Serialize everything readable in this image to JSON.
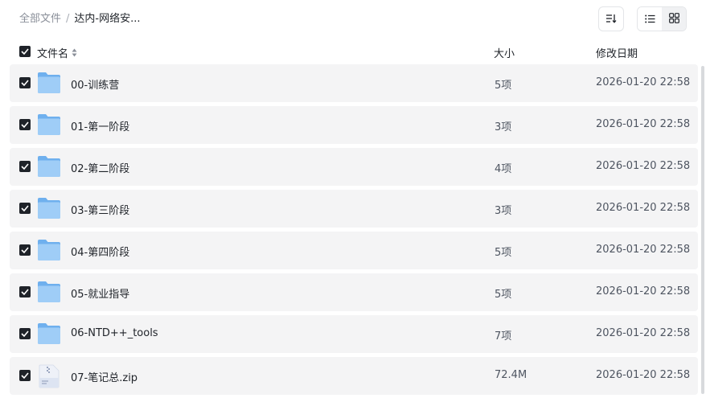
{
  "breadcrumb": {
    "root": "全部文件",
    "separator": "/",
    "current": "达内-网络安..."
  },
  "toolbar": {
    "sort_icon": "sort-list-icon",
    "list_view_icon": "list-view-icon",
    "grid_view_icon": "grid-view-icon"
  },
  "header": {
    "name": "文件名",
    "size": "大小",
    "modified": "修改日期"
  },
  "files": [
    {
      "name": "00-训练营",
      "type": "folder",
      "size": "5项",
      "modified": "2026-01-20 22:58"
    },
    {
      "name": "01-第一阶段",
      "type": "folder",
      "size": "3项",
      "modified": "2026-01-20 22:58"
    },
    {
      "name": "02-第二阶段",
      "type": "folder",
      "size": "4项",
      "modified": "2026-01-20 22:58"
    },
    {
      "name": "03-第三阶段",
      "type": "folder",
      "size": "3项",
      "modified": "2026-01-20 22:58"
    },
    {
      "name": "04-第四阶段",
      "type": "folder",
      "size": "5项",
      "modified": "2026-01-20 22:58"
    },
    {
      "name": "05-就业指导",
      "type": "folder",
      "size": "5项",
      "modified": "2026-01-20 22:58"
    },
    {
      "name": "06-NTD++_tools",
      "type": "folder",
      "size": "7项",
      "modified": "2026-01-20 22:58"
    },
    {
      "name": "07-笔记总.zip",
      "type": "zip",
      "size": "72.4M",
      "modified": "2026-01-20 22:58"
    }
  ],
  "colors": {
    "folder": "#8ec3f5",
    "row_bg": "#f4f4f5",
    "checkbox": "#1f2329"
  }
}
